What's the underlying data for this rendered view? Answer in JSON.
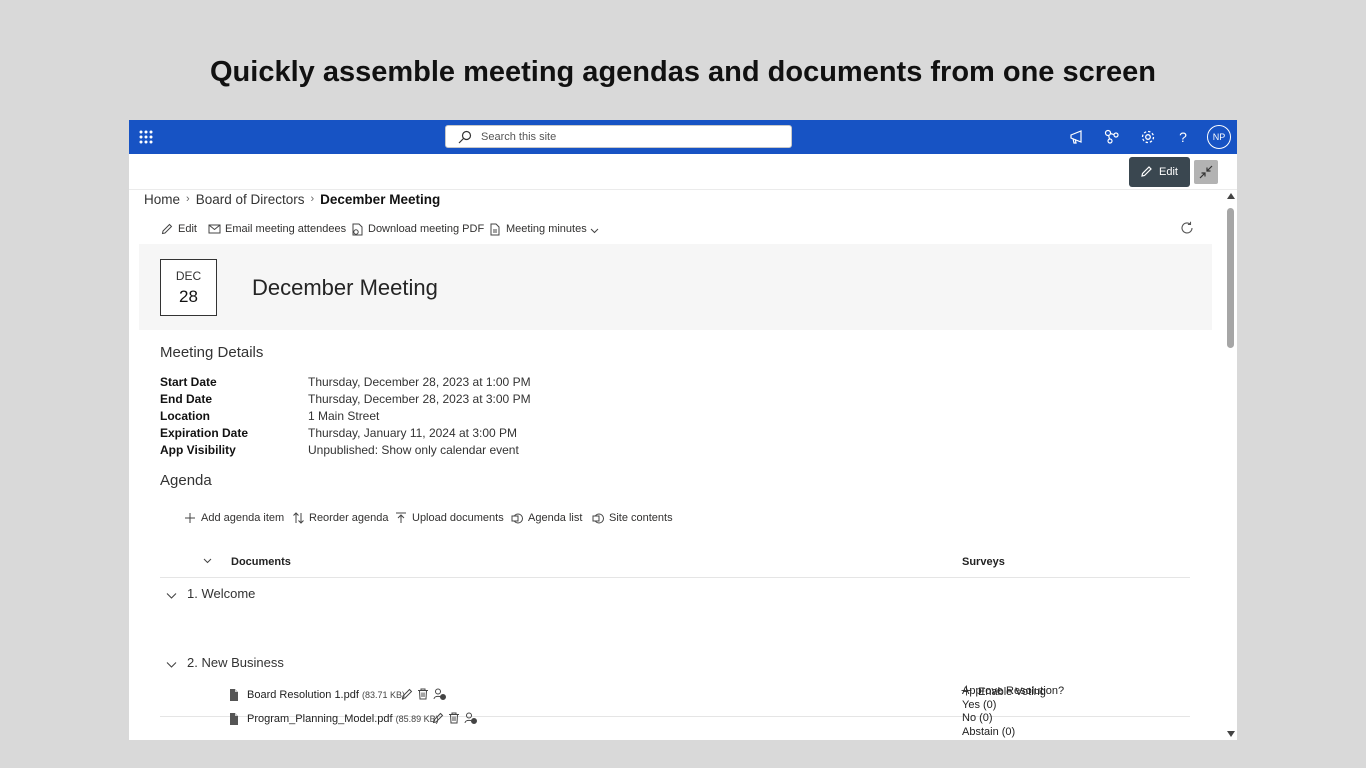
{
  "headline": "Quickly assemble meeting agendas and documents from one screen",
  "colors": {
    "suite_bar": "#1753c4",
    "edit_button": "#3a4750",
    "hero_bg": "#f6f6f6"
  },
  "search": {
    "placeholder": "Search this site"
  },
  "topbar_icons": [
    "app-launcher-icon",
    "megaphone-icon",
    "share-network-icon",
    "gear-icon",
    "help-icon"
  ],
  "user": {
    "initials": "NP"
  },
  "editbar": {
    "edit_label": "Edit"
  },
  "breadcrumb": {
    "home": "Home",
    "parent": "Board of Directors",
    "current": "December Meeting"
  },
  "commands": {
    "edit": "Edit",
    "email": "Email meeting attendees",
    "download": "Download meeting PDF",
    "minutes": "Meeting minutes"
  },
  "meeting": {
    "month": "DEC",
    "day": "28",
    "title": "December Meeting"
  },
  "details": {
    "title": "Meeting Details",
    "rows": [
      {
        "label": "Start Date",
        "value": "Thursday, December 28, 2023 at 1:00 PM"
      },
      {
        "label": "End Date",
        "value": "Thursday, December 28, 2023 at 3:00 PM"
      },
      {
        "label": "Location",
        "value": "1 Main Street"
      },
      {
        "label": "Expiration Date",
        "value": "Thursday, January 11, 2024 at 3:00 PM"
      },
      {
        "label": "App Visibility",
        "value": "Unpublished: Show only calendar event"
      }
    ]
  },
  "agenda": {
    "title": "Agenda",
    "actions": {
      "add": "Add agenda item",
      "reorder": "Reorder agenda",
      "upload": "Upload documents",
      "list": "Agenda list",
      "site": "Site contents"
    },
    "columns": {
      "documents": "Documents",
      "surveys": "Surveys"
    },
    "items": [
      {
        "label": "1. Welcome",
        "enable_voting": "Enable Voting"
      },
      {
        "label": "2. New Business",
        "documents": [
          {
            "name": "Board Resolution 1.pdf",
            "size": "(83.71 KB)"
          },
          {
            "name": "Program_Planning_Model.pdf",
            "size": "(85.89 KB)"
          }
        ],
        "survey": {
          "question": "Approve Resolution?",
          "options": [
            "Yes (0)",
            "No (0)",
            "Abstain (0)"
          ]
        }
      }
    ]
  }
}
